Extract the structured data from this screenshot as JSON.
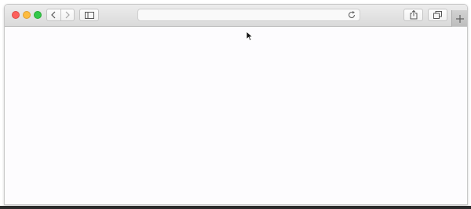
{
  "window": {
    "traffic_lights": [
      "close",
      "minimize",
      "zoom"
    ],
    "colors": {
      "close": "#fc605c",
      "minimize": "#fdbc40",
      "zoom": "#34c84a"
    }
  },
  "toolbar": {
    "back_icon": "chevron-left-icon",
    "forward_icon": "chevron-right-icon",
    "sidebar_icon": "sidebar-icon",
    "share_icon": "share-icon",
    "tabs_icon": "tab-overview-icon",
    "new_tab_icon": "plus-icon"
  },
  "address_bar": {
    "value": "",
    "placeholder": "",
    "reload_icon": "reload-icon"
  },
  "page": {
    "content": ""
  }
}
